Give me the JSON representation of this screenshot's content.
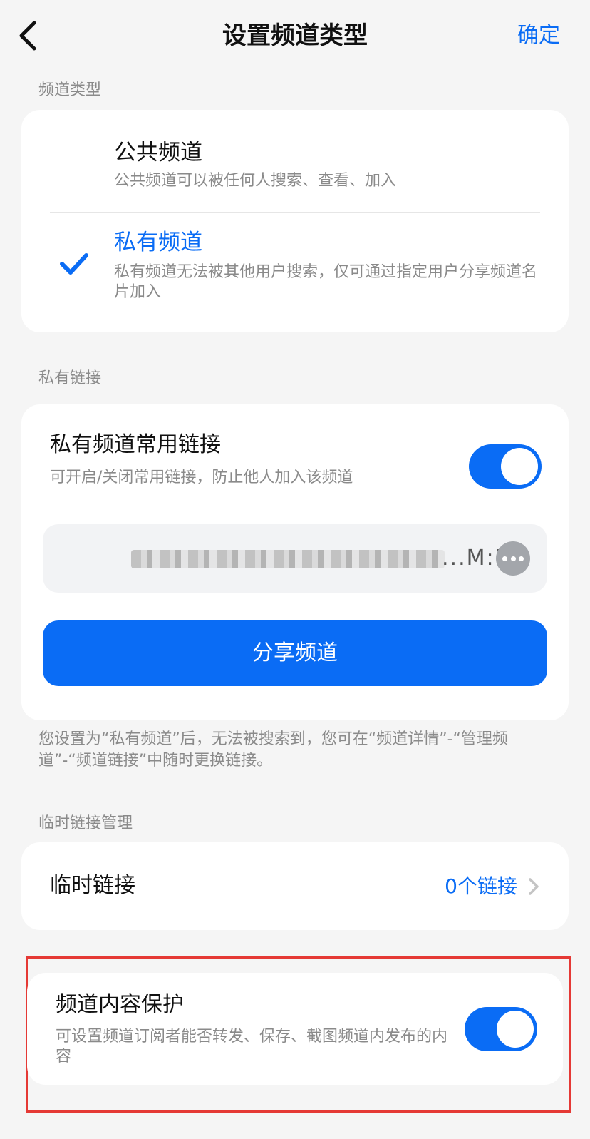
{
  "nav": {
    "title": "设置频道类型",
    "confirm": "确定"
  },
  "channel_type": {
    "section_label": "频道类型",
    "options": [
      {
        "title": "公共频道",
        "desc": "公共频道可以被任何人搜索、查看、加入",
        "selected": false
      },
      {
        "title": "私有频道",
        "desc": "私有频道无法被其他用户搜索，仅可通过指定用户分享频道名片加入",
        "selected": true
      }
    ]
  },
  "private_link": {
    "section_label": "私有链接",
    "title": "私有频道常用链接",
    "desc": "可开启/关闭常用链接，防止他人加入该频道",
    "enabled": true,
    "link_visible_tail": "...M:7",
    "share_button": "分享频道"
  },
  "note": "您设置为“私有频道”后，无法被搜索到，您可在“频道详情”-“管理频道”-“频道链接”中随时更换链接。",
  "temp_link": {
    "section_label": "临时链接管理",
    "title": "临时链接",
    "value": "0个链接"
  },
  "protect": {
    "title": "频道内容保护",
    "desc": "可设置频道订阅者能否转发、保存、截图频道内发布的内容",
    "enabled": true
  },
  "colors": {
    "accent": "#0a6cf5",
    "highlight_border": "#e53935"
  }
}
